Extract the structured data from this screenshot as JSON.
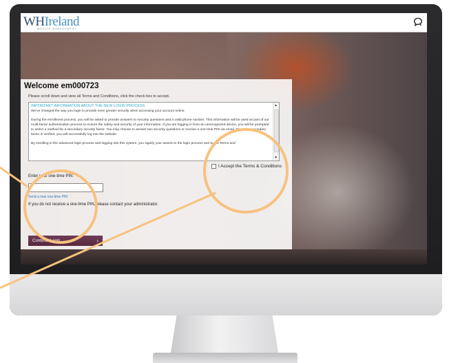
{
  "header": {
    "logo_wh": "WH",
    "logo_ireland": "Ireland",
    "logo_sub": "WEALTH MANAGEMENT",
    "chat_icon": "chat-bubble-icon"
  },
  "login": {
    "welcome": "Welcome em000723",
    "instruction": "Please scroll down and view all Terms and Conditions, click the check box to accept.",
    "terms": {
      "heading": "IMPORTANT INFORMATION ABOUT THE NEW LOGIN PROCESS",
      "para1": "We've changed the way you login to provide even greater security when accessing your account online.",
      "para2": "During the enrollment process, you will be asked to provide answers to security questions and a valid phone number. This information will be used as part of our multi-factor authentication process to ensure the safety and security of your information. If you are logging in from an unrecognized device, you will be prompted to select a method for a secondary security factor. You may choose to answer two security questions or receive a one-time PIN via email. Once the secondary factor is verified, you will successfully log into the website.",
      "para3": "By enrolling in the advanced login process and logging into this system, you signify your assent to the login process and to the Terms and"
    },
    "accept_label": "I Accept the Terms & Conditions",
    "pin_label": "Enter your one-time PIN:",
    "pin_value": "",
    "send_pin_link": "Send a new one-time PIN",
    "no_pin_text": "If you do not receive a one-time PIN, please contact your administrator.",
    "continue_label": "Continue Login",
    "continue_chevron": "›"
  },
  "colors": {
    "accent_circle": "#F7C27E",
    "button": "#5E2E45",
    "link": "#2A7AB8",
    "heading": "#29A9C9"
  }
}
